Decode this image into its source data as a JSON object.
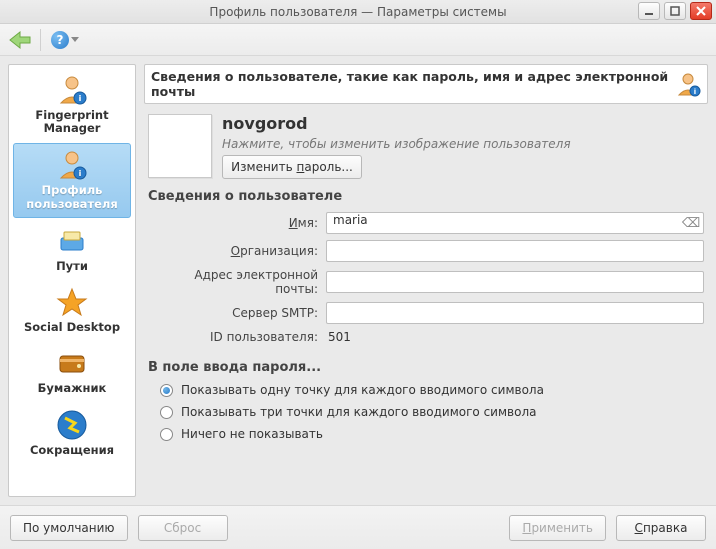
{
  "window": {
    "title": "Профиль пользователя — Параметры системы"
  },
  "sidebar": {
    "items": [
      {
        "label": "Fingerprint Manager",
        "icon": "user-finger-icon"
      },
      {
        "label": "Профиль пользователя",
        "icon": "user-profile-icon",
        "selected": true
      },
      {
        "label": "Пути",
        "icon": "paths-icon"
      },
      {
        "label": "Social Desktop",
        "icon": "star-icon"
      },
      {
        "label": "Бумажник",
        "icon": "wallet-icon"
      },
      {
        "label": "Сокращения",
        "icon": "shortcuts-icon"
      }
    ]
  },
  "banner": {
    "text": "Сведения о пользователе, такие как пароль, имя и адрес электронной почты"
  },
  "profile": {
    "username": "novgorod",
    "hint": "Нажмите, чтобы изменить изображение пользователя",
    "change_password_label": "Изменить пароль..."
  },
  "user_details": {
    "section_title": "Сведения о пользователе",
    "name_label": "Имя:",
    "name_value": "maria",
    "org_label": "Организация:",
    "org_value": "",
    "email_label": "Адрес электронной почты:",
    "email_value": "",
    "smtp_label": "Сервер SMTP:",
    "smtp_value": "",
    "userid_label": "ID пользователя:",
    "userid_value": "501"
  },
  "password_field_options": {
    "section_title": "В поле ввода пароля...",
    "opts": [
      {
        "label": "Показывать одну точку для каждого вводимого символа",
        "checked": true
      },
      {
        "label": "Показывать три точки для каждого вводимого символа",
        "checked": false
      },
      {
        "label": "Ничего не показывать",
        "checked": false
      }
    ]
  },
  "buttons": {
    "defaults": "По умолчанию",
    "reset": "Сброс",
    "apply": "Применить",
    "help": "Справка"
  }
}
